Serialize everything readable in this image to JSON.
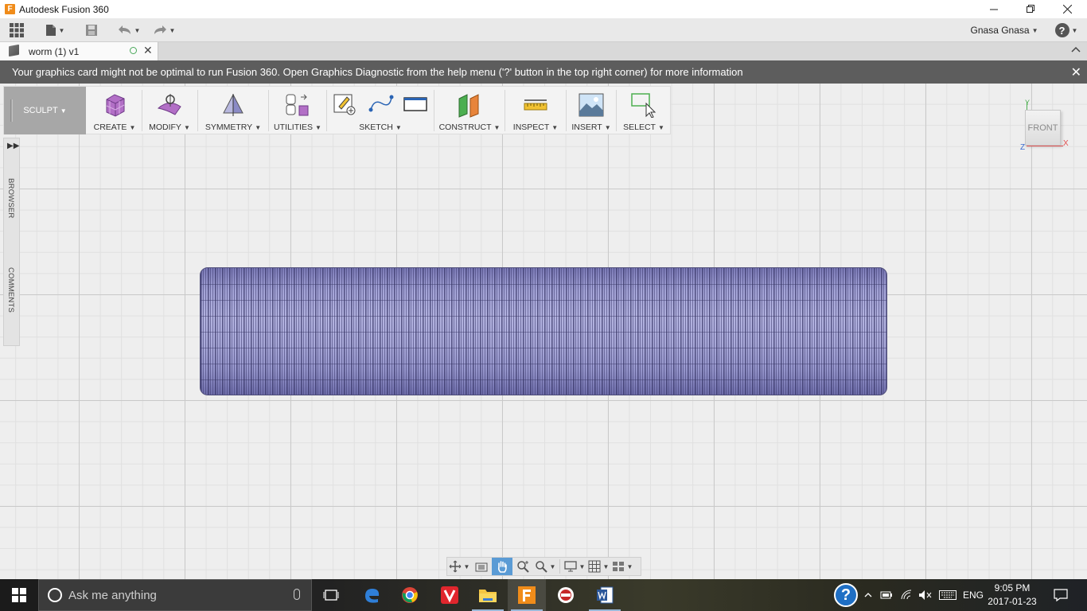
{
  "titlebar": {
    "title": "Autodesk Fusion 360",
    "logo_letter": "F"
  },
  "apptoolbar": {
    "user_name": "Gnasa Gnasa",
    "help_label": "?"
  },
  "document_tab": {
    "name": "worm (1) v1"
  },
  "banner": {
    "message": "Your graphics card might not be optimal to run Fusion 360. Open Graphics Diagnostic from the help menu ('?' button in the top right corner) for more information"
  },
  "ribbon": {
    "workspace": "SCULPT",
    "groups": [
      {
        "label": "CREATE"
      },
      {
        "label": "MODIFY"
      },
      {
        "label": "SYMMETRY"
      },
      {
        "label": "UTILITIES"
      },
      {
        "label": "SKETCH"
      },
      {
        "label": "CONSTRUCT"
      },
      {
        "label": "INSPECT"
      },
      {
        "label": "INSERT"
      },
      {
        "label": "SELECT"
      }
    ]
  },
  "leftpanel": {
    "browser": "BROWSER",
    "comments": "COMMENTS"
  },
  "viewcube": {
    "face": "FRONT",
    "axis_y": "Y",
    "axis_x": "X",
    "axis_z": "Z"
  },
  "taskbar": {
    "search_placeholder": "Ask me anything",
    "language": "ENG",
    "time": "9:05 PM",
    "date": "2017-01-23"
  },
  "colors": {
    "model": "#a3a3d6",
    "banner": "#5d5d5d",
    "workspace": "#a7a7a7",
    "active_nav": "#5a9bd5"
  }
}
